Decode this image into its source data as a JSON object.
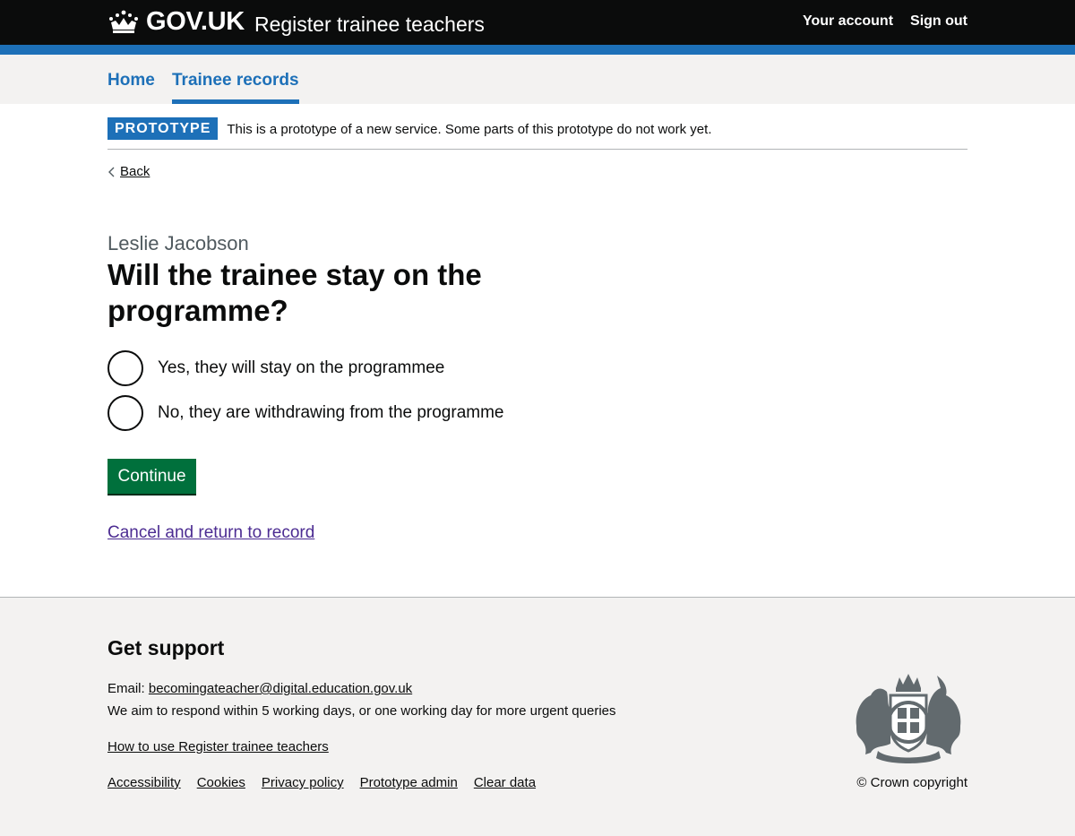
{
  "header": {
    "brand": "GOV.UK",
    "service_name": "Register trainee teachers",
    "account_link": "Your account",
    "signout_link": "Sign out"
  },
  "primary_nav": {
    "home": "Home",
    "trainee_records": "Trainee records"
  },
  "phase_banner": {
    "tag": "PROTOTYPE",
    "text": "This is a prototype of a new service. Some parts of this prototype do not work yet."
  },
  "back_link": "Back",
  "caption": "Leslie Jacobson",
  "heading": "Will the trainee stay on the programme?",
  "radios": [
    {
      "label": "Yes, they will stay on the programmee"
    },
    {
      "label": "No, they are withdrawing from the programme"
    }
  ],
  "continue_button": "Continue",
  "cancel_link": "Cancel and return to record",
  "footer": {
    "title": "Get support",
    "email_label": "Email:",
    "email": "becomingateacher@digital.education.gov.uk",
    "respond_text": "We aim to respond within 5 working days, or one working day for more urgent queries",
    "how_to": "How to use Register trainee teachers",
    "links": [
      "Accessibility",
      "Cookies",
      "Privacy policy",
      "Prototype admin",
      "Clear data"
    ],
    "copyright": "© Crown copyright"
  },
  "colors": {
    "header_bg": "#0b0c0c",
    "brand_blue": "#1d70b8",
    "button_green": "#00703c",
    "visited_link": "#4c2c92",
    "footer_bg": "#f3f2f1"
  }
}
